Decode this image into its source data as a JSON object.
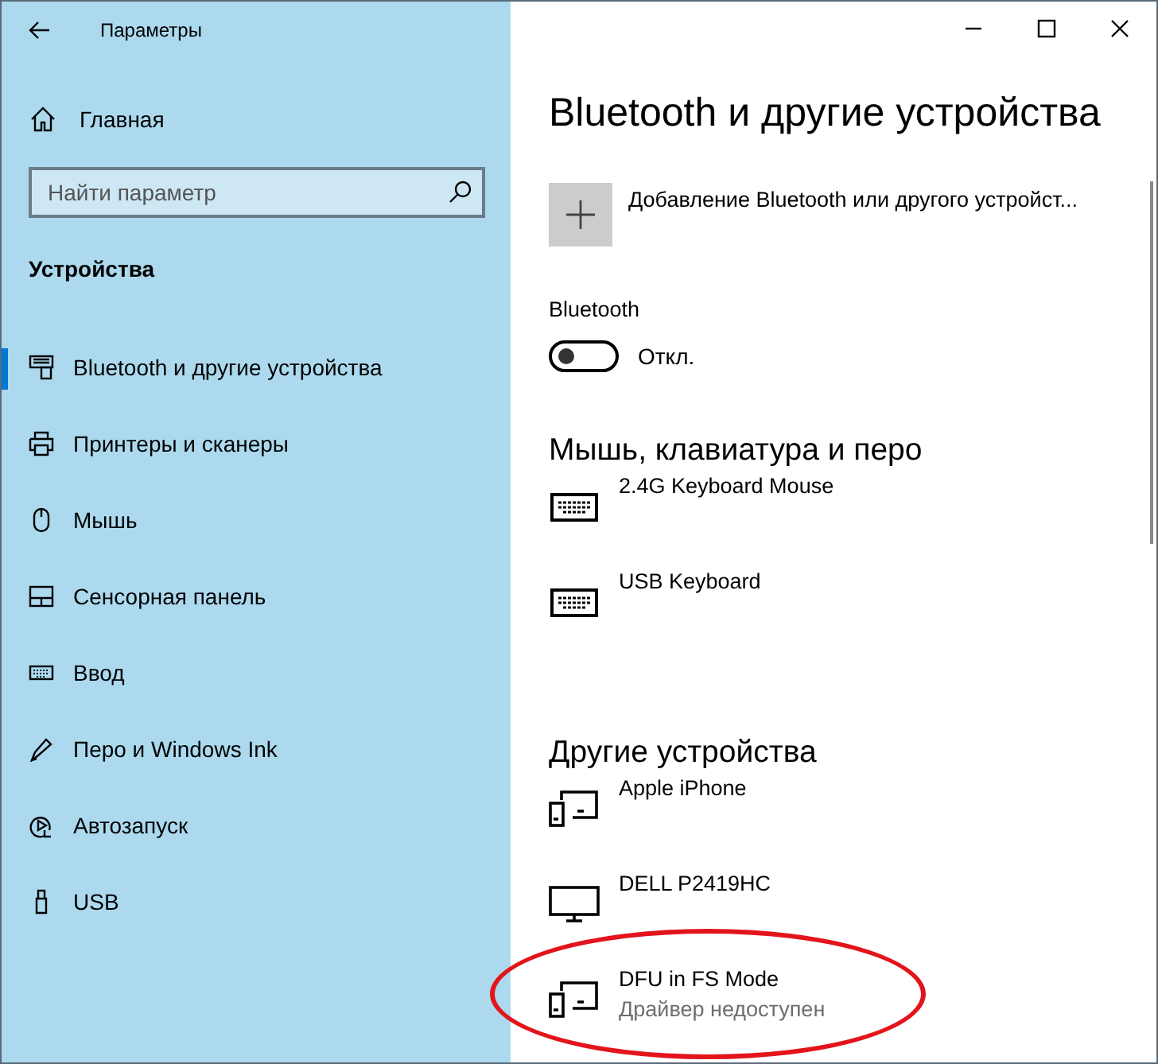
{
  "window": {
    "title": "Параметры"
  },
  "sidebar": {
    "home": "Главная",
    "search": {
      "placeholder": "Найти параметр"
    },
    "section": "Устройства",
    "items": [
      {
        "label": "Bluetooth и другие устройства",
        "kind": "bluetooth",
        "selected": true
      },
      {
        "label": "Принтеры и сканеры",
        "kind": "printer",
        "selected": false
      },
      {
        "label": "Мышь",
        "kind": "mouse",
        "selected": false
      },
      {
        "label": "Сенсорная панель",
        "kind": "touchpad",
        "selected": false
      },
      {
        "label": "Ввод",
        "kind": "keyboard",
        "selected": false
      },
      {
        "label": "Перо и Windows Ink",
        "kind": "pen",
        "selected": false
      },
      {
        "label": "Автозапуск",
        "kind": "autoplay",
        "selected": false
      },
      {
        "label": "USB",
        "kind": "usb",
        "selected": false
      }
    ]
  },
  "page": {
    "title": "Bluetooth и другие устройства",
    "add_device": "Добавление Bluetooth или другого устройст...",
    "bluetooth": {
      "label": "Bluetooth",
      "on": false,
      "state_text": "Откл."
    },
    "sections": [
      {
        "title": "Мышь, клавиатура и перо",
        "devices": [
          {
            "name": "2.4G Keyboard Mouse",
            "kind": "keyboard",
            "highlighted": false
          },
          {
            "name": "USB Keyboard",
            "kind": "keyboard",
            "highlighted": false
          }
        ]
      },
      {
        "title": "Другие устройства",
        "devices": [
          {
            "name": "Apple iPhone",
            "kind": "devices",
            "highlighted": false
          },
          {
            "name": "DELL P2419HC",
            "kind": "monitor",
            "highlighted": false
          },
          {
            "name": "DFU in FS Mode",
            "kind": "devices",
            "status": "Драйвер недоступен",
            "highlighted": true
          }
        ]
      }
    ]
  }
}
